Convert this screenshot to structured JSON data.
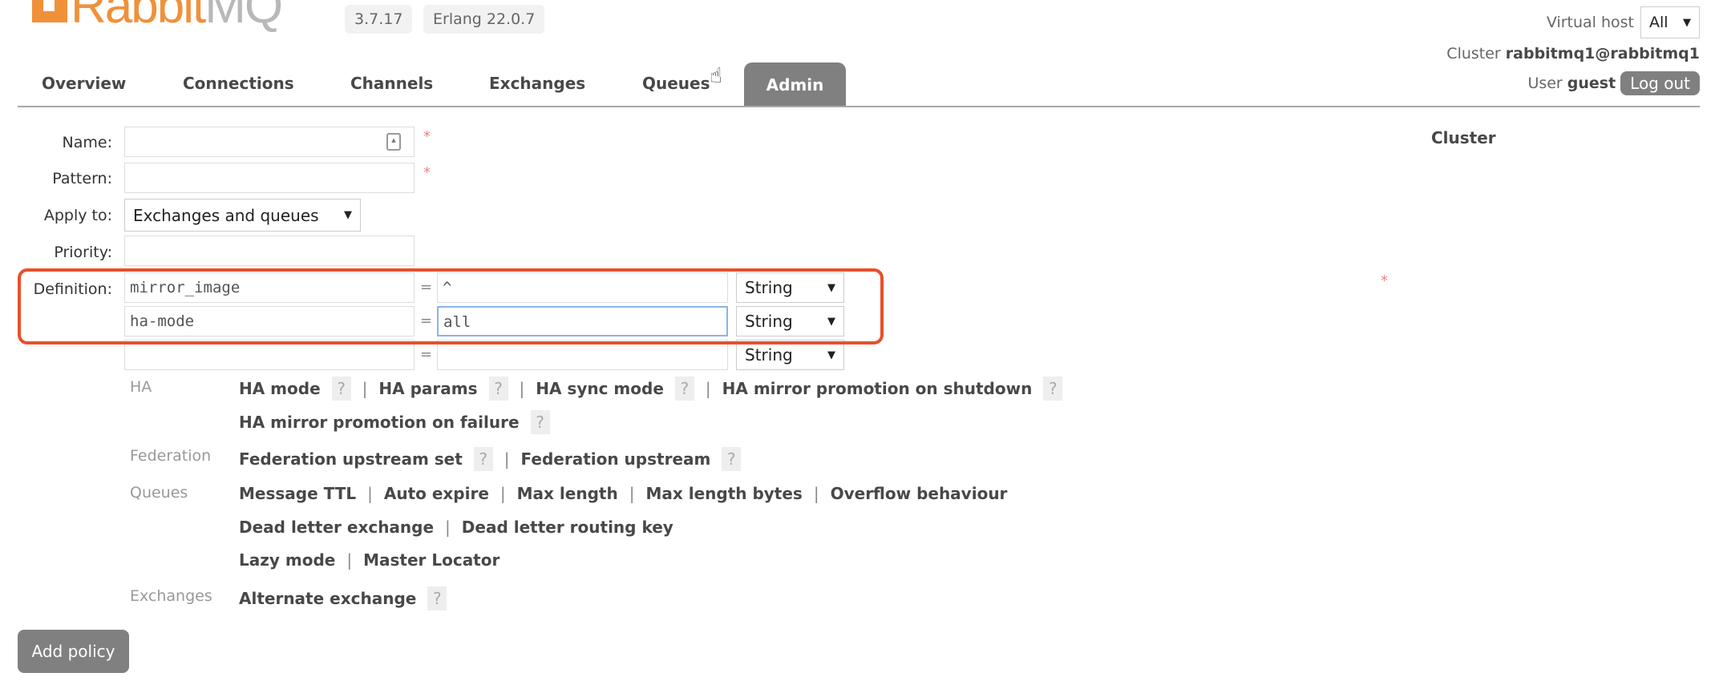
{
  "header": {
    "logo": "RabbitMQ",
    "version": "3.7.17",
    "erlang": "Erlang 22.0.7",
    "virtual_host_label": "Virtual host",
    "virtual_host_value": "All",
    "cluster_label": "Cluster",
    "cluster_name": "rabbitmq1@rabbitmq1",
    "user_label": "User",
    "user_name": "guest",
    "logout": "Log out"
  },
  "tabs": [
    "Overview",
    "Connections",
    "Channels",
    "Exchanges",
    "Queues",
    "Admin"
  ],
  "active_tab": "Admin",
  "side_heading": "Cluster",
  "form": {
    "name_label": "Name:",
    "name_value": "",
    "pattern_label": "Pattern:",
    "pattern_value": "",
    "apply_label": "Apply to:",
    "apply_value": "Exchanges and queues",
    "priority_label": "Priority:",
    "priority_value": "",
    "definition_label": "Definition:",
    "required": "*",
    "eq": "=",
    "definitions": [
      {
        "key": "mirror_image",
        "value": "^",
        "type": "String"
      },
      {
        "key": "ha-mode",
        "value": "all",
        "type": "String"
      },
      {
        "key": "",
        "value": "",
        "type": "String"
      }
    ]
  },
  "help": {
    "ha_label": "HA",
    "ha_row1": [
      "HA mode",
      "HA params",
      "HA sync mode",
      "HA mirror promotion on shutdown"
    ],
    "ha_row2": "HA mirror promotion on failure",
    "federation_label": "Federation",
    "federation": [
      "Federation upstream set",
      "Federation upstream"
    ],
    "queues_label": "Queues",
    "queues_row1": [
      "Message TTL",
      "Auto expire",
      "Max length",
      "Max length bytes",
      "Overflow behaviour"
    ],
    "queues_row2": [
      "Dead letter exchange",
      "Dead letter routing key"
    ],
    "queues_row3": [
      "Lazy mode",
      "Master Locator"
    ],
    "exchanges_label": "Exchanges",
    "exchanges": "Alternate exchange",
    "question": "?",
    "sep": "|"
  },
  "add_policy": "Add policy",
  "colors": {
    "highlight": "#e8502a",
    "brand": "#f0913a",
    "tab_active": "#808080"
  }
}
